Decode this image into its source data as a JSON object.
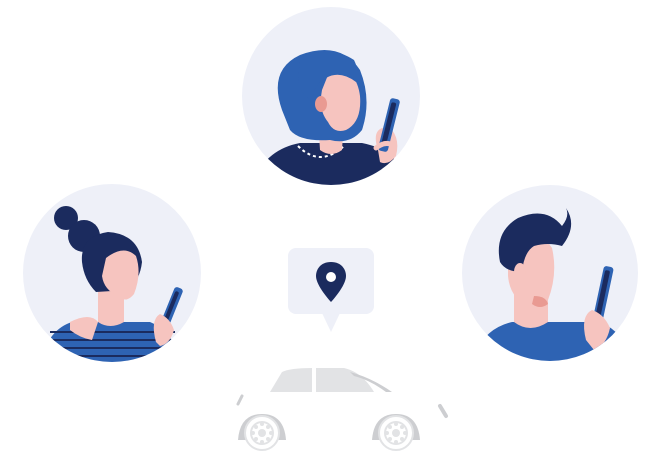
{
  "illustration": {
    "people": [
      {
        "id": "woman-top",
        "role": "passenger"
      },
      {
        "id": "woman-left",
        "role": "passenger"
      },
      {
        "id": "man-right",
        "role": "passenger"
      }
    ],
    "icons": [
      "map-pin-icon",
      "car-icon"
    ],
    "colors": {
      "circle_bg": "#EEF0F8",
      "navy": "#1B2B5E",
      "blue": "#2E63B3",
      "skin": "#F6C4BF",
      "skin_shadow": "#E99A92",
      "phone": "#2E63B3",
      "car_body": "#E2E3E5",
      "car_shadow": "#CDCED1",
      "pin_bubble": "#EEF0F8"
    }
  }
}
